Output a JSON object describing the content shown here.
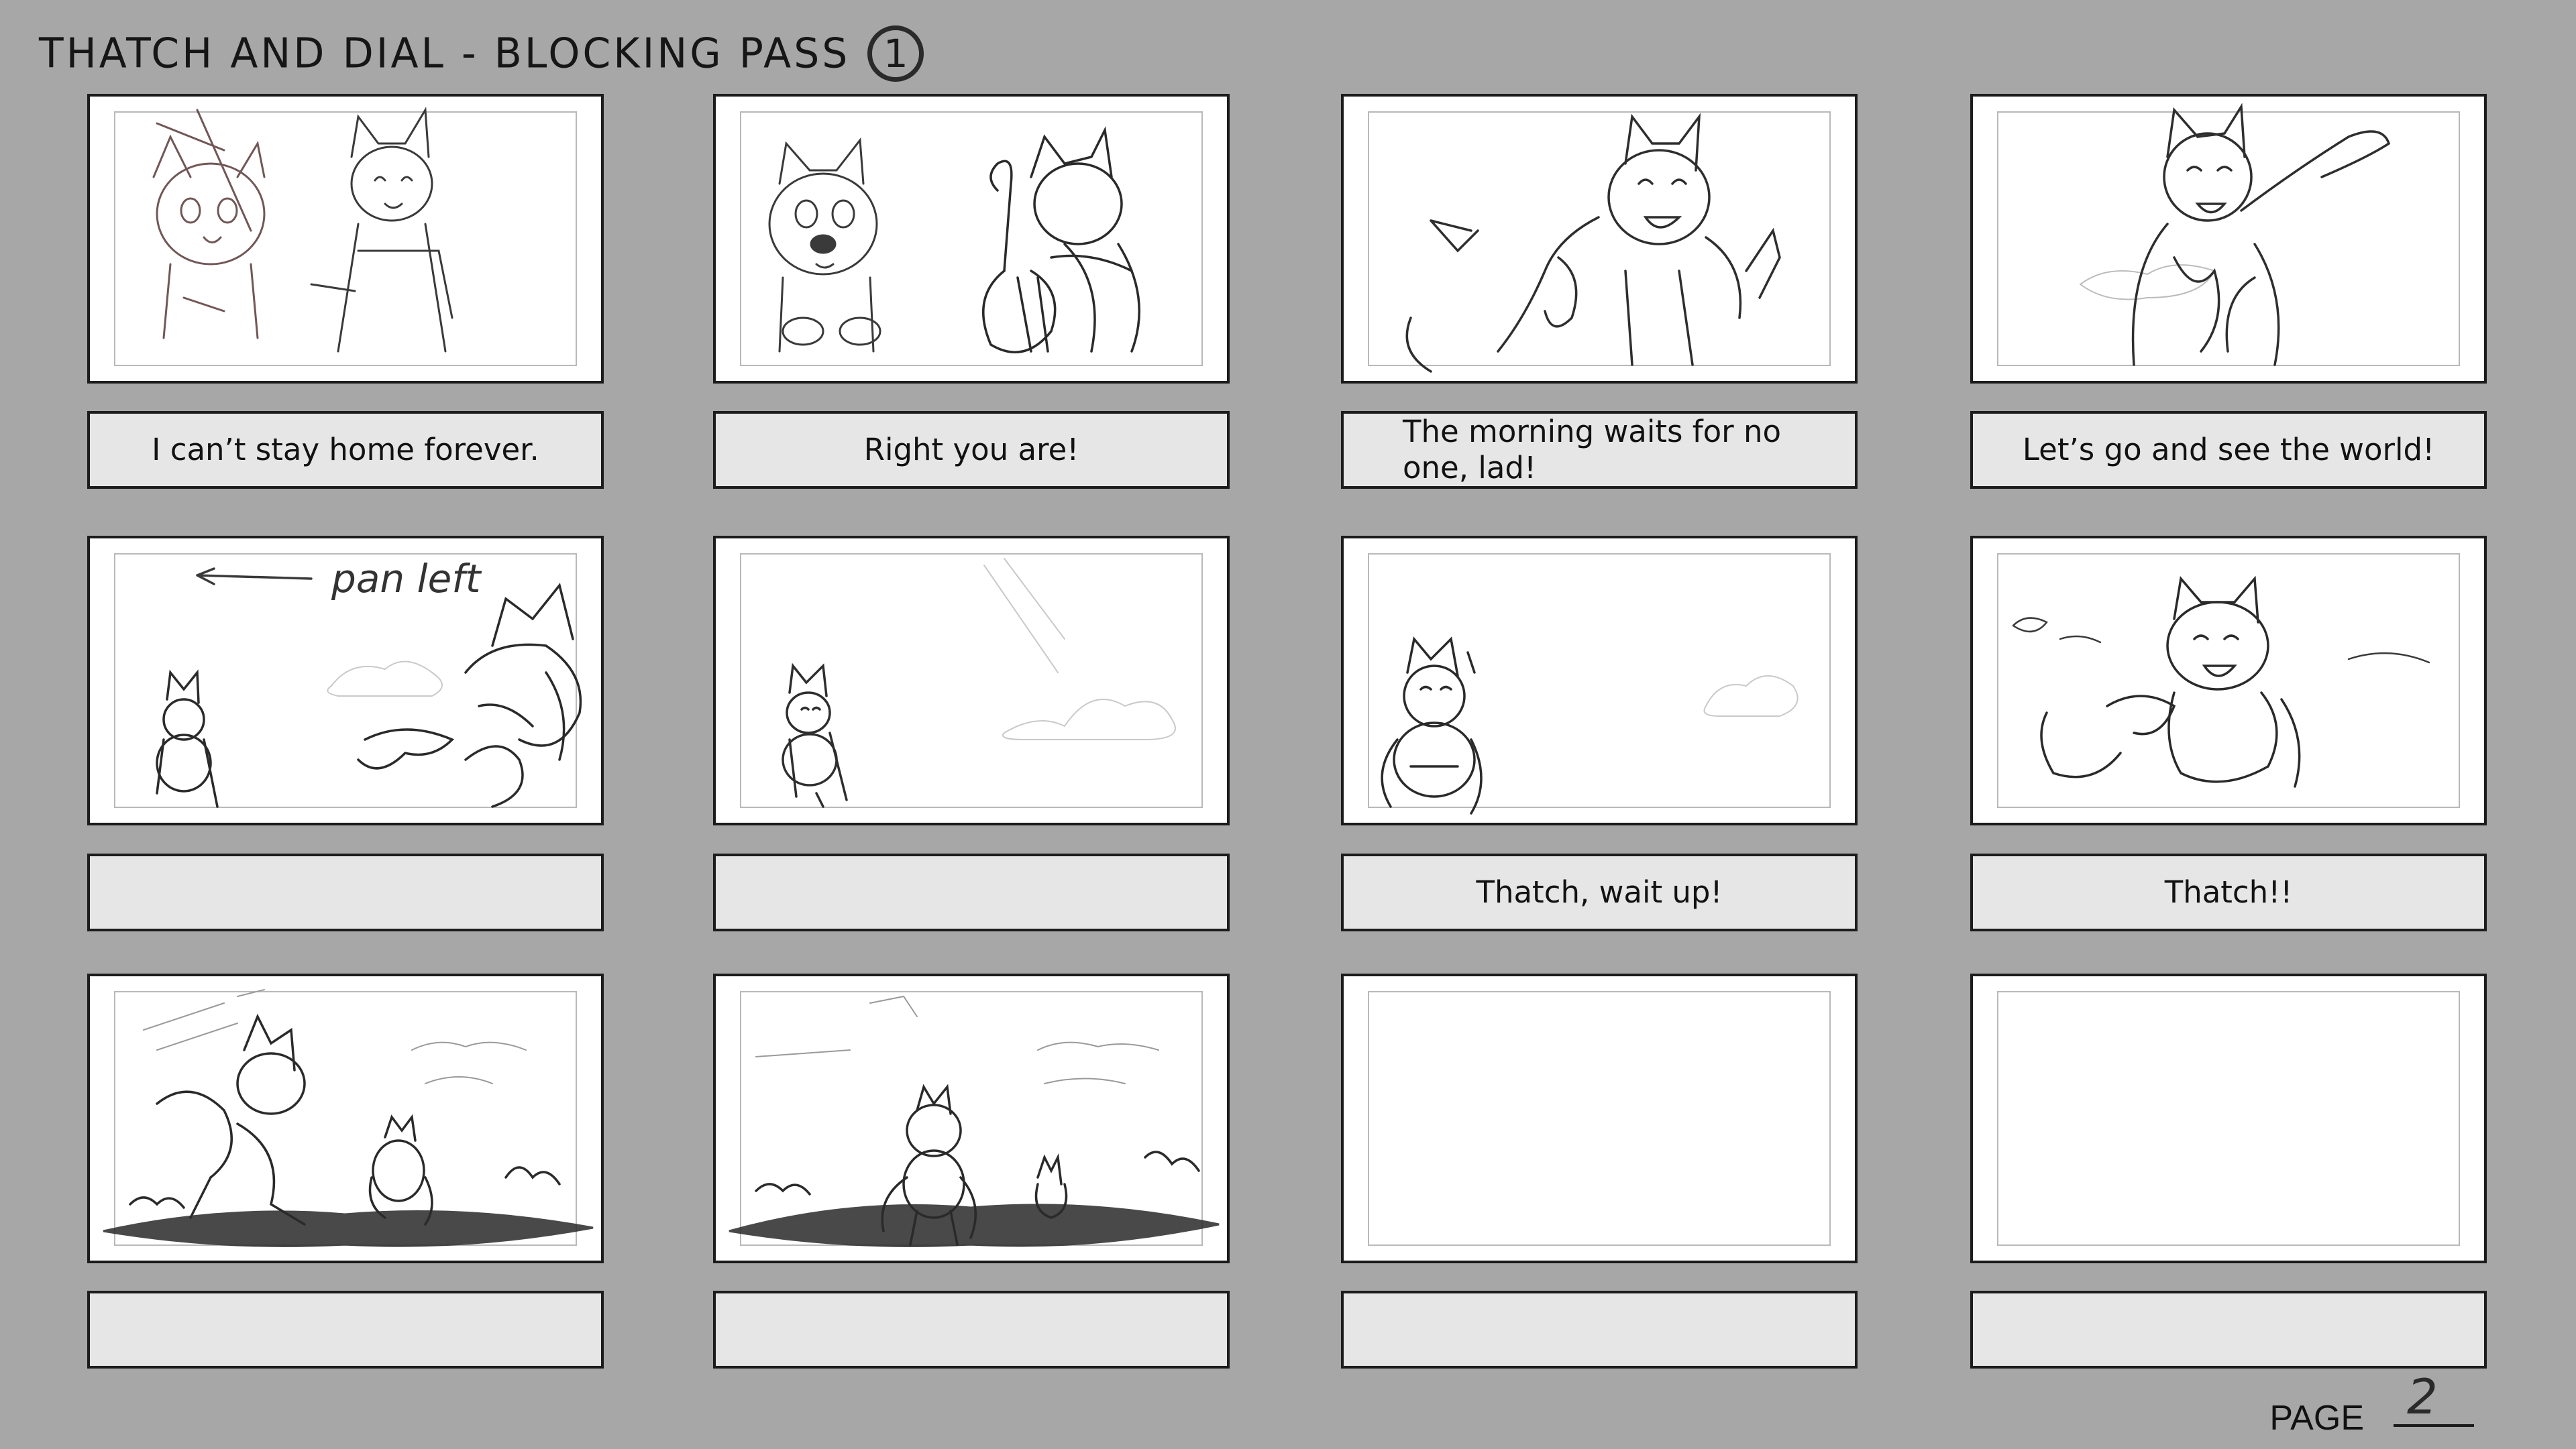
{
  "title": "THATCH AND DIAL - BLOCKING PASS",
  "pass_number": "1",
  "page_label": "PAGE",
  "page_number": "2",
  "panels": [
    {
      "caption": "I can’t stay home forever.",
      "annotation": ""
    },
    {
      "caption": "Right you are!",
      "annotation": ""
    },
    {
      "caption": "The morning waits for no one, lad!",
      "annotation": ""
    },
    {
      "caption": "Let’s go and see the world!",
      "annotation": ""
    },
    {
      "caption": "",
      "annotation": "pan left"
    },
    {
      "caption": "",
      "annotation": ""
    },
    {
      "caption": "Thatch, wait up!",
      "annotation": ""
    },
    {
      "caption": "Thatch!!",
      "annotation": ""
    },
    {
      "caption": "",
      "annotation": ""
    },
    {
      "caption": "",
      "annotation": ""
    },
    {
      "caption": "",
      "annotation": ""
    },
    {
      "caption": "",
      "annotation": ""
    }
  ],
  "colors": {
    "background": "#a7a7a7",
    "caption_box": "#e6e6e6",
    "sketch_stroke": "#3a3a3a"
  }
}
